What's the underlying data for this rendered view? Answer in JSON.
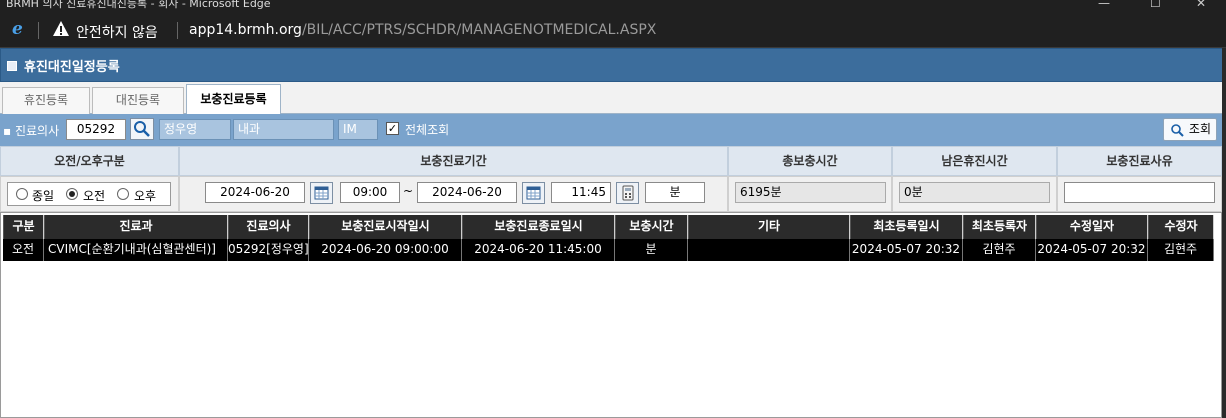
{
  "browser": {
    "window_title": "BRMH 의사 진료휴진대진등록 - 회사 - Microsoft Edge",
    "security_warning": "안전하지 않음",
    "url_host": "app14.brmh.org",
    "url_path": "/BIL/ACC/PTRS/SCHDR/MANAGENOTMEDICAL.ASPX"
  },
  "app": {
    "title": "휴진대진일정등록"
  },
  "tabs": [
    {
      "label": "휴진등록"
    },
    {
      "label": "대진등록"
    },
    {
      "label": "보충진료등록",
      "active": true
    }
  ],
  "search": {
    "doctor_label": "진료의사",
    "doctor_id": "05292",
    "doctor_name": "정우영",
    "dept_name": "내과",
    "dept_code": "IM",
    "show_all_label": "전체조회",
    "show_all_checked": true,
    "search_button": "조회"
  },
  "conditions": {
    "headers": [
      "오전/오후구분",
      "보충진료기간",
      "총보충시간",
      "남은휴진시간",
      "보충진료사유"
    ],
    "radio_options": [
      "종일",
      "오전",
      "오후"
    ],
    "radio_selected": "오전",
    "start_date": "2024-06-20",
    "start_time": "09:00",
    "range_sep": "~",
    "end_date": "2024-06-20",
    "end_time": "11:45",
    "unit": "분",
    "total_time": "6195분",
    "remaining_time": "0분",
    "reason": ""
  },
  "grid": {
    "columns": [
      "구분",
      "진료과",
      "진료의사",
      "보충진료시작일시",
      "보충진료종료일시",
      "보충시간",
      "기타",
      "최초등록일시",
      "최초등록자",
      "수정일자",
      "수정자"
    ],
    "rows": [
      [
        "오전",
        "CVIMC[순환기내과(심혈관센터)]",
        "05292[정우영]",
        "2024-06-20 09:00:00",
        "2024-06-20 11:45:00",
        "분",
        "",
        "2024-05-07 20:32",
        "김현주",
        "2024-05-07 20:32",
        "김현주"
      ]
    ]
  },
  "colors": {
    "app_title_bg": "#3c6d9c",
    "search_bar_bg": "#7aa3cc",
    "grid_header_bg": "#2b2b2b",
    "selected_row_bg": "#000000"
  }
}
